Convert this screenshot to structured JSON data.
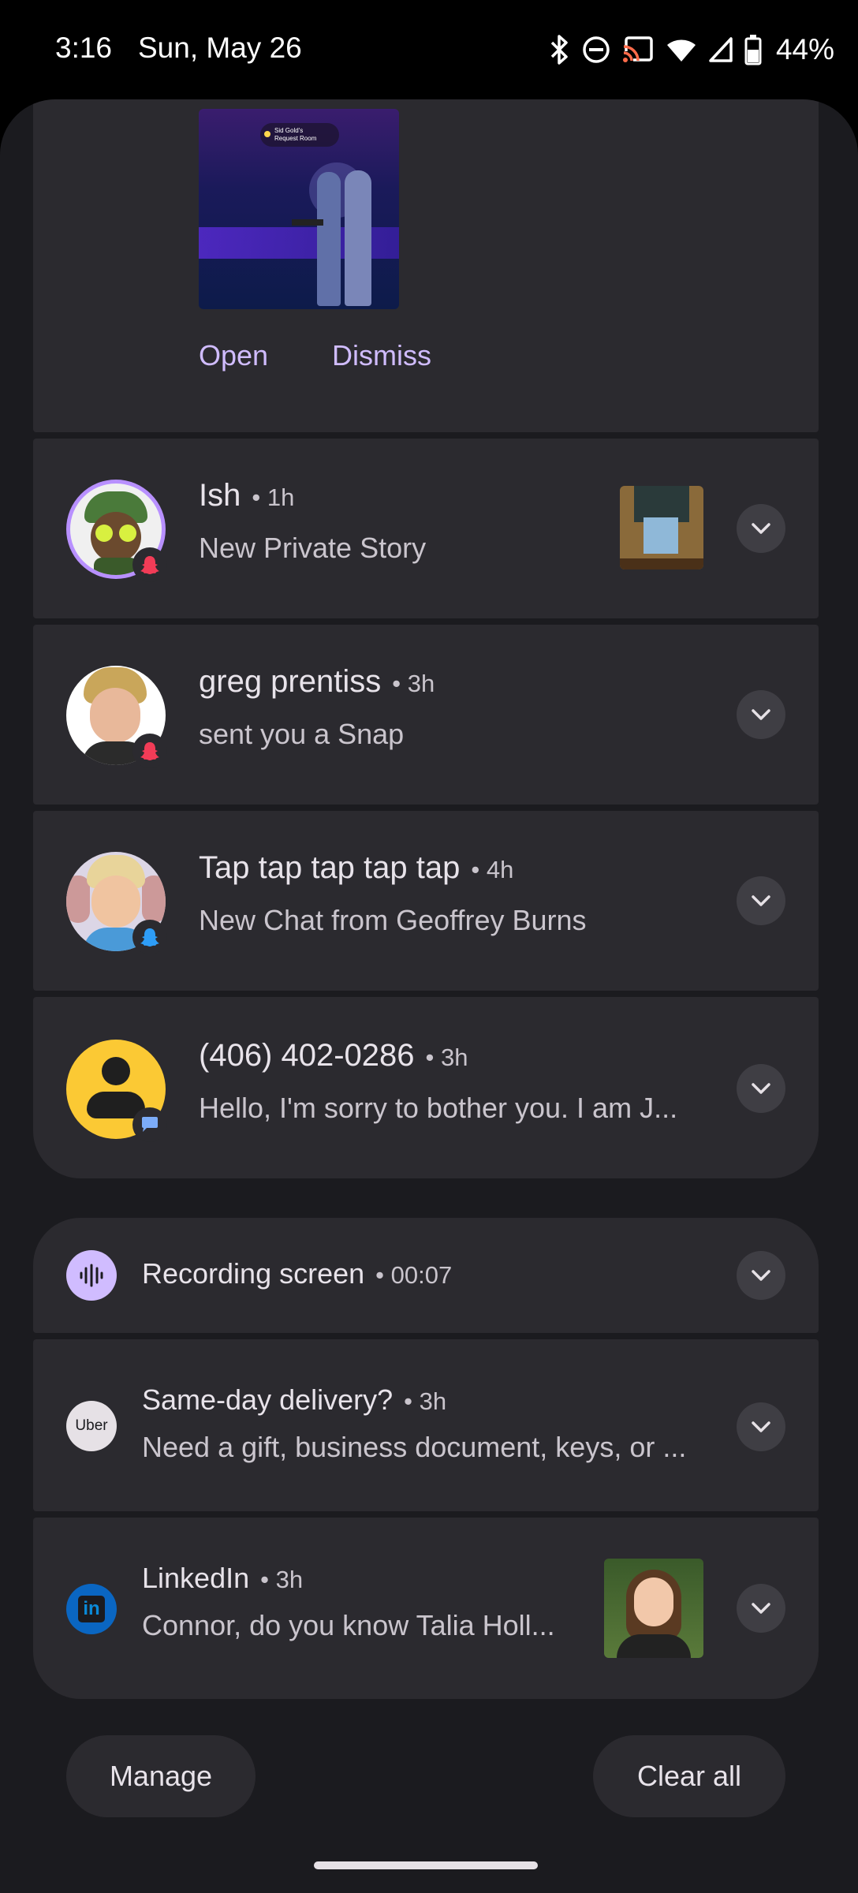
{
  "status_bar": {
    "time": "3:16",
    "date": "Sun, May 26",
    "battery": "44%",
    "icons": [
      "bluetooth-icon",
      "do-not-disturb-icon",
      "cast-icon",
      "wifi-icon",
      "cell-signal-icon",
      "battery-icon"
    ]
  },
  "snap_preview": {
    "image_caption_line1": "Sid Gold's",
    "image_caption_line2": "Request Room",
    "open_label": "Open",
    "dismiss_label": "Dismiss"
  },
  "conversations": [
    {
      "title": "Ish",
      "time": "1h",
      "body": "New Private Story",
      "badge": "snapchat-red"
    },
    {
      "title": "greg prentiss",
      "time": "3h",
      "body": "sent you a Snap",
      "badge": "snapchat-red"
    },
    {
      "title": "Tap tap tap tap tap",
      "time": "4h",
      "body": "New Chat from Geoffrey Burns",
      "badge": "snapchat-blue"
    },
    {
      "title": "(406) 402-0286",
      "time": "3h",
      "body": "Hello, I'm sorry to bother you. I am J...",
      "badge": "messages"
    }
  ],
  "alerts": {
    "recording": {
      "title": "Recording screen",
      "time": "00:07"
    },
    "uber": {
      "title": "Same-day delivery?",
      "time": "3h",
      "body": "Need a gift, business document, keys, or ...",
      "icon_text": "Uber"
    },
    "linkedin": {
      "title": "LinkedIn",
      "time": "3h",
      "body": "Connor, do you know Talia Holl...",
      "icon_text": "in"
    }
  },
  "footer": {
    "manage_label": "Manage",
    "clear_all_label": "Clear all"
  },
  "colors": {
    "accent": "#d0bcff",
    "snap_red": "#f23c57",
    "snap_blue": "#2e9df7",
    "linkedin": "#0a66c2"
  }
}
